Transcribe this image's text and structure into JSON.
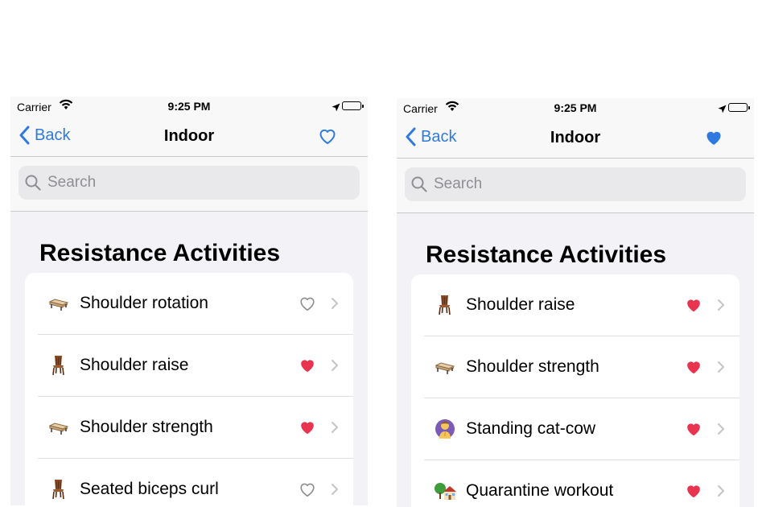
{
  "colors": {
    "accent": "#2f7ae0",
    "favorite": "#e8344e",
    "heart_outline": "#8e8e93"
  },
  "left": {
    "status": {
      "carrier": "Carrier",
      "time": "9:25 PM"
    },
    "nav": {
      "back": "Back",
      "title": "Indoor",
      "favorited": false
    },
    "search": {
      "placeholder": "Search"
    },
    "section_title": "Resistance Activities",
    "rows": [
      {
        "icon": "bench-icon",
        "label": "Shoulder rotation",
        "favorite": false
      },
      {
        "icon": "chair-icon",
        "label": "Shoulder raise",
        "favorite": true
      },
      {
        "icon": "bench-icon",
        "label": "Shoulder strength",
        "favorite": true
      },
      {
        "icon": "chair-icon",
        "label": "Seated biceps curl",
        "favorite": false
      }
    ]
  },
  "right": {
    "status": {
      "carrier": "Carrier",
      "time": "9:25 PM"
    },
    "nav": {
      "back": "Back",
      "title": "Indoor",
      "favorited": true
    },
    "search": {
      "placeholder": "Search"
    },
    "section_title": "Resistance Activities",
    "rows": [
      {
        "icon": "chair-icon",
        "label": "Shoulder raise",
        "favorite": true
      },
      {
        "icon": "bench-icon",
        "label": "Shoulder strength",
        "favorite": true
      },
      {
        "icon": "person-yoga-icon",
        "label": "Standing cat-cow",
        "favorite": true
      },
      {
        "icon": "house-tree-icon",
        "label": "Quarantine workout",
        "favorite": true
      }
    ]
  }
}
